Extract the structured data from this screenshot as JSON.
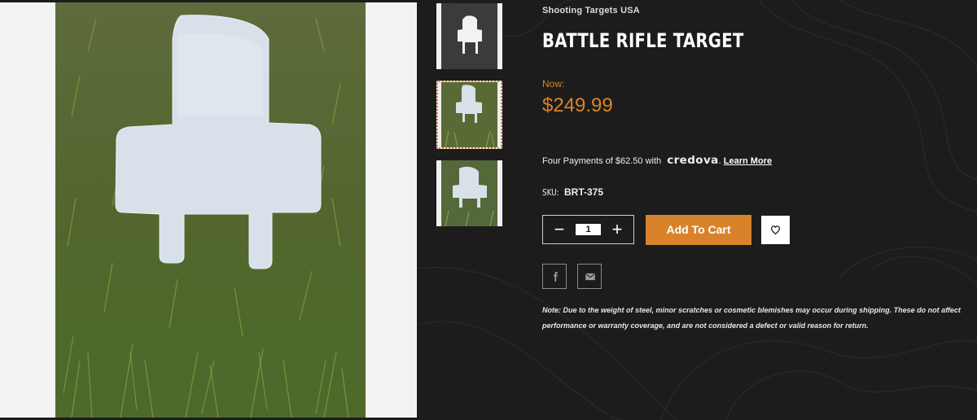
{
  "product": {
    "brand": "Shooting Targets USA",
    "title": "BATTLE RIFLE TARGET",
    "price_label": "Now:",
    "price": "$249.99",
    "payments_text": "Four Payments of $62.50 with",
    "payments_provider": "credova",
    "payments_dot": ".",
    "learn_more": "Learn More",
    "sku_label": "SKU:",
    "sku": "BRT-375"
  },
  "cart": {
    "decrement": "−",
    "quantity": "1",
    "increment": "+",
    "add_to_cart": "Add To Cart",
    "wishlist_icon": "heart-icon"
  },
  "share": {
    "facebook_icon": "facebook-icon",
    "email_icon": "email-icon"
  },
  "note": "Note: Due to the weight of steel, minor scratches or cosmetic blemishes may occur during shipping. These do not affect performance or warranty coverage, and are not considered a defect or valid reason for return.",
  "colors": {
    "background": "#1c1c1c",
    "accent": "#d8832a",
    "text": "#ffffff"
  }
}
